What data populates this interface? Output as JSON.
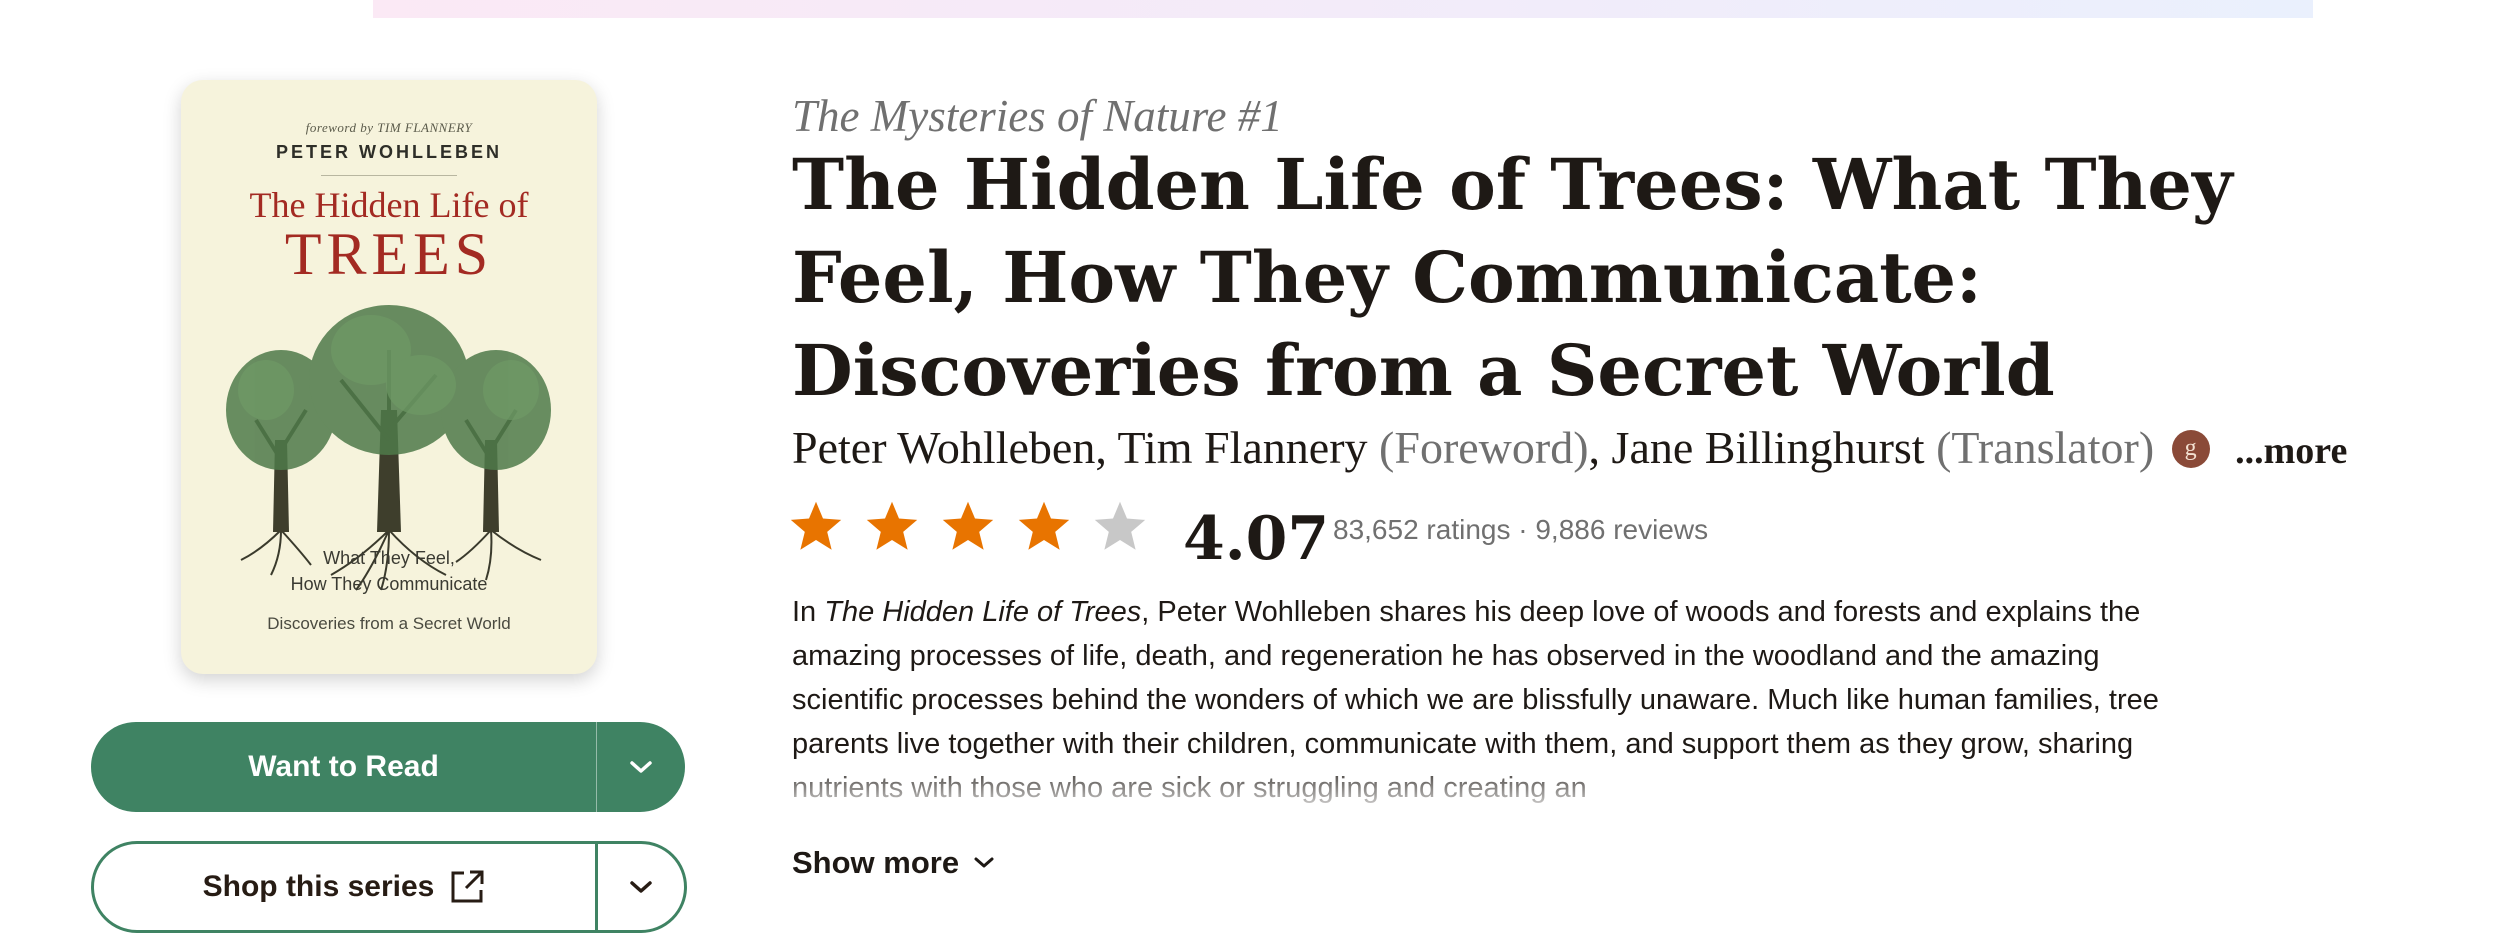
{
  "cover": {
    "foreword_line": "foreword by TIM FLANNERY",
    "author_line": "PETER WOHLLEBEN",
    "title_line1": "The Hidden Life of",
    "title_line2": "TREES",
    "subtitle_line1": "What They Feel,",
    "subtitle_line2": "How They Communicate",
    "subtitle_line3": "Discoveries from a Secret World"
  },
  "actions": {
    "want_to_read": "Want to Read",
    "shop_series": "Shop this series"
  },
  "book": {
    "series": "The Mysteries of Nature #1",
    "title": "The Hidden Life of Trees: What They Feel, How They Communicate: Discoveries from a Secret World",
    "contributors": {
      "author1": "Peter Wohlleben",
      "sep1": ", ",
      "author2": "Tim Flannery",
      "role2": " (Foreword)",
      "sep2": ", ",
      "author3": "Jane Billinghurst",
      "role3": " (Translator)",
      "badge": "g",
      "more": "...more"
    },
    "rating": {
      "value": "4.07",
      "stars_filled": 4,
      "stars_total": 5,
      "counts": "83,652 ratings · 9,886 reviews"
    },
    "description": {
      "prefix": "In ",
      "italic_title": "The Hidden Life of Trees",
      "body": ", Peter Wohlleben shares his deep love of woods and forests and explains the amazing processes of life, death, and regeneration he has observed in the woodland and the amazing scientific processes behind the wonders of which we are blissfully unaware. Much like human families, tree parents live together with their children, communicate with them, and support them as they grow, sharing nutrients with those who are sick or struggling and creating an"
    },
    "show_more": "Show more"
  },
  "colors": {
    "primary_green": "#3f8363",
    "star_filled": "#e87400",
    "star_empty": "#c8c8c8",
    "cover_title_red": "#a32a22",
    "muted_text": "#707070"
  },
  "icons": {
    "want_caret": "chevron-down-icon",
    "shop_external": "external-link-icon",
    "shop_caret": "chevron-down-icon",
    "show_more_caret": "chevron-down-icon",
    "star": "star-icon"
  }
}
